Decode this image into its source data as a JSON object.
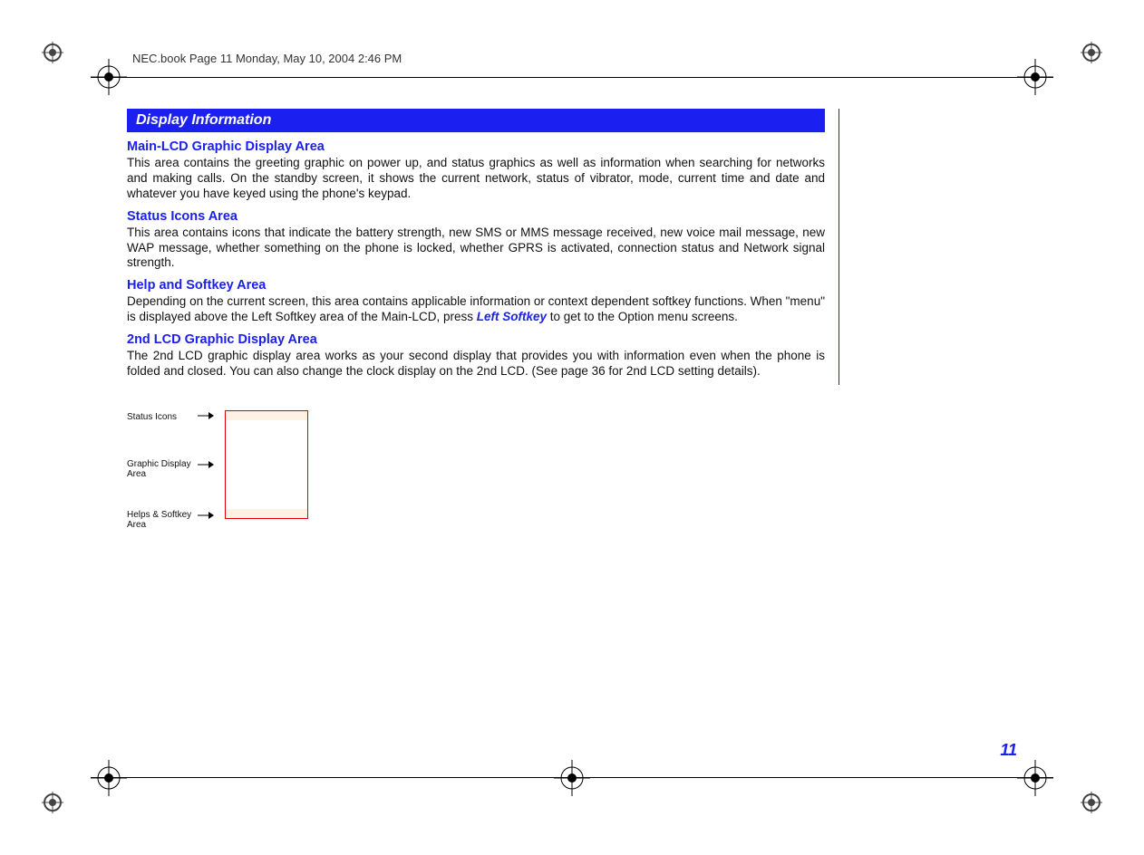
{
  "header": "NEC.book  Page 11  Monday, May 10, 2004  2:46 PM",
  "banner": "Display Information",
  "sections": {
    "s1_title": "Main-LCD Graphic Display Area",
    "s1_body": "This area contains the greeting graphic on power up, and status graphics as well as information when searching for networks and making calls. On the standby screen, it shows the current network, status of vibrator, mode, current time and date and whatever you have keyed using the phone's keypad.",
    "s2_title": "Status Icons Area",
    "s2_body": "This area contains icons that indicate the battery strength, new SMS or MMS message received, new voice mail message, new WAP message, whether something on the phone is locked, whether GPRS is activated, connection status and Network signal strength.",
    "s3_title": "Help and Softkey Area",
    "s3_body_a": "Depending on the current screen, this area contains applicable information or context dependent softkey functions. When \"menu\" is displayed above the Left Softkey area of the Main-LCD, press ",
    "s3_emph": "Left Softkey",
    "s3_body_b": " to get to the Option menu screens.",
    "s4_title": "2nd LCD Graphic Display Area",
    "s4_body": "The 2nd LCD graphic display area works as your second display that provides you with information even when the phone is folded and closed. You can also change the clock display on the 2nd LCD. (See page 36 for 2nd LCD setting details)."
  },
  "side_labels": {
    "l1": "Status Icons",
    "l2": "Graphic Display Area",
    "l3": "Helps & Softkey Area"
  },
  "page_number": "11"
}
